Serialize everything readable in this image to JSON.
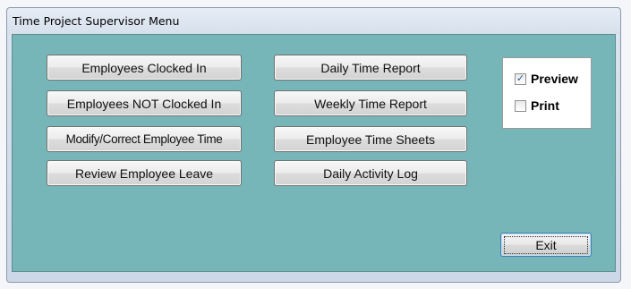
{
  "window": {
    "title": "Time Project Supervisor Menu"
  },
  "buttons": {
    "employees_clocked_in": "Employees Clocked In",
    "employees_not_clocked_in": "Employees NOT Clocked In",
    "modify_correct_time": "Modify/Correct Employee Time",
    "review_leave": "Review Employee Leave",
    "daily_time_report": "Daily Time Report",
    "weekly_time_report": "Weekly Time Report",
    "employee_time_sheets": "Employee Time Sheets",
    "daily_activity_log": "Daily Activity Log",
    "exit": "Exit"
  },
  "output_options": {
    "preview": {
      "label": "Preview",
      "checked": true
    },
    "print": {
      "label": "Print",
      "checked": false
    }
  },
  "colors": {
    "client_background": "#76b5b8",
    "checkmark": "#2a4fa0"
  },
  "icons": {
    "checkbox_checked": "check-mark",
    "checkbox_unchecked": "empty-box"
  }
}
